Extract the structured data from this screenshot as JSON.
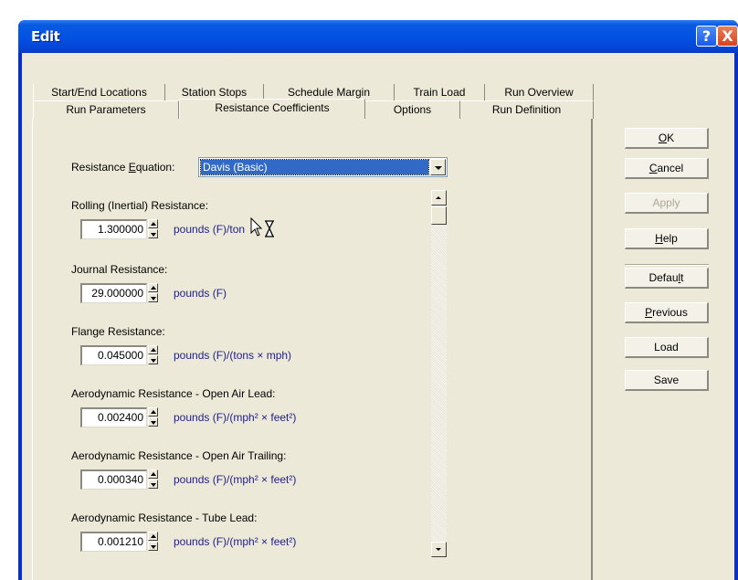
{
  "window": {
    "title": "Edit",
    "help_button": "?",
    "close_button": "X"
  },
  "tabs": {
    "row1": [
      "Start/End Locations",
      "Station Stops",
      "Schedule Margin",
      "Train Load",
      "Run Overview"
    ],
    "row2": [
      "Run Parameters",
      "Resistance Coefficients",
      "Options",
      "Run Definition"
    ],
    "active": "Resistance Coefficients"
  },
  "buttons": {
    "ok": "OK",
    "cancel": "Cancel",
    "apply": "Apply",
    "help": "Help",
    "default": "Default",
    "previous": "Previous",
    "load": "Load",
    "save": "Save"
  },
  "equation": {
    "label_pre": "Resistance ",
    "label_key": "E",
    "label_post": "quation:",
    "value": "Davis (Basic)"
  },
  "fields": [
    {
      "label": "Rolling (Inertial) Resistance:",
      "value": "1.300000",
      "unit": "pounds (F)/ton"
    },
    {
      "label": "Journal Resistance:",
      "value": "29.000000",
      "unit": "pounds (F)"
    },
    {
      "label": "Flange Resistance:",
      "value": "0.045000",
      "unit": "pounds (F)/(tons × mph)"
    },
    {
      "label": "Aerodynamic Resistance - Open Air Lead:",
      "value": "0.002400",
      "unit": "pounds (F)/(mph² × feet²)"
    },
    {
      "label": "Aerodynamic Resistance - Open Air Trailing:",
      "value": "0.000340",
      "unit": "pounds (F)/(mph² × feet²)"
    },
    {
      "label": "Aerodynamic Resistance - Tube Lead:",
      "value": "0.001210",
      "unit": "pounds (F)/(mph² × feet²)"
    }
  ],
  "cursor": {
    "icon": "arrow-hourglass-busy-cursor"
  }
}
